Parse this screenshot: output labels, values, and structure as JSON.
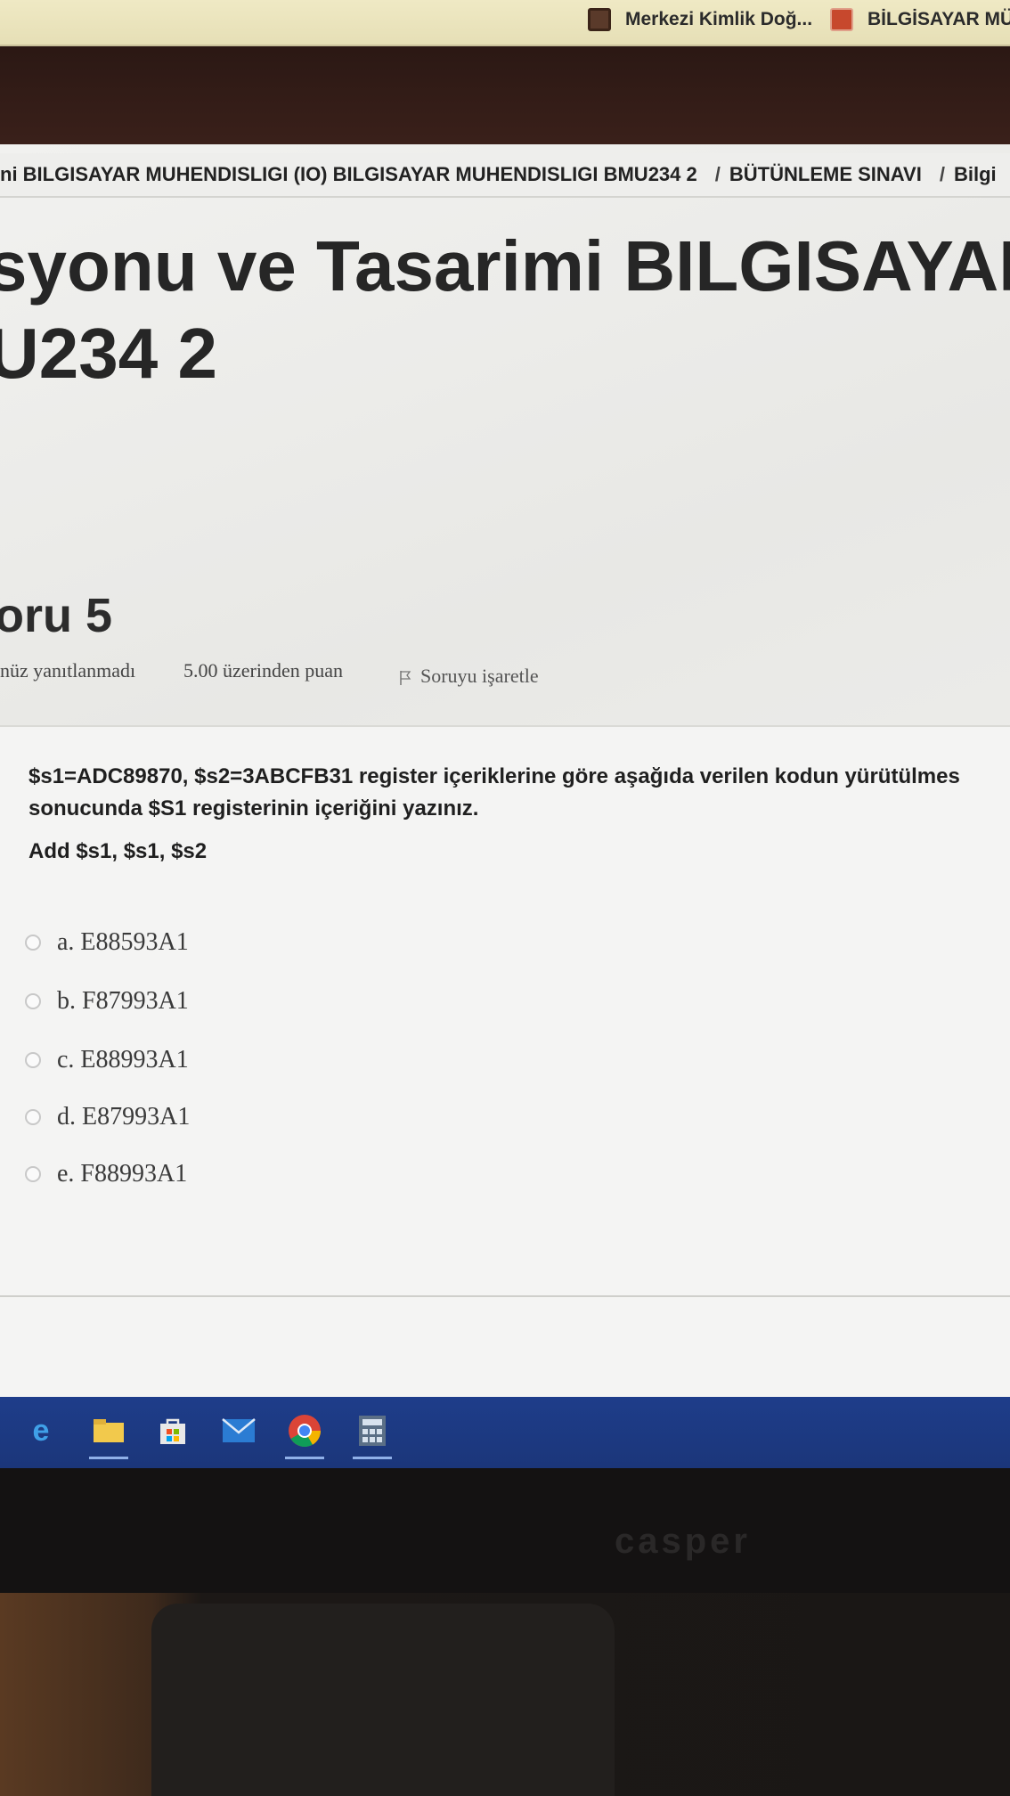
{
  "bookmarks": [
    {
      "label": "Merkezi Kimlik Doğ..."
    },
    {
      "label": "BİLGİSAYAR MÜH"
    }
  ],
  "breadcrumb": {
    "items": [
      "ni BILGISAYAR MUHENDISLIGI (IO) BILGISAYAR MUHENDISLIGI BMU234 2",
      "BÜTÜNLEME SINAVI",
      "Bilgi"
    ],
    "separator": "/"
  },
  "course": {
    "title_line1": "syonu ve Tasarimi BILGISAYAR M",
    "title_line2": "U234 2"
  },
  "question": {
    "heading": "oru 5",
    "status": "nüz yanıtlanmadı",
    "points": "5.00 üzerinden puan",
    "flag_label": "Soruyu işaretle",
    "text_line1": "$s1=ADC89870, $s2=3ABCFB31 register içeriklerine göre aşağıda verilen kodun yürütülmes",
    "text_line2": "sonucunda $S1 registerinin içeriğini yazınız.",
    "code": "Add $s1, $s1, $s2",
    "answers": [
      {
        "label": "a. E88593A1"
      },
      {
        "label": "b. F87993A1"
      },
      {
        "label": "c. E88993A1"
      },
      {
        "label": "d. E87993A1"
      },
      {
        "label": "e. F88993A1"
      }
    ]
  },
  "taskbar": {
    "icons": [
      "edge-icon",
      "file-explorer-icon",
      "store-icon",
      "mail-icon",
      "chrome-icon",
      "calculator-icon"
    ]
  },
  "monitor": {
    "logo": "casper"
  },
  "colors": {
    "header": "#2b1814",
    "taskbar": "#1e3d8a",
    "page": "#f1f1ef"
  }
}
